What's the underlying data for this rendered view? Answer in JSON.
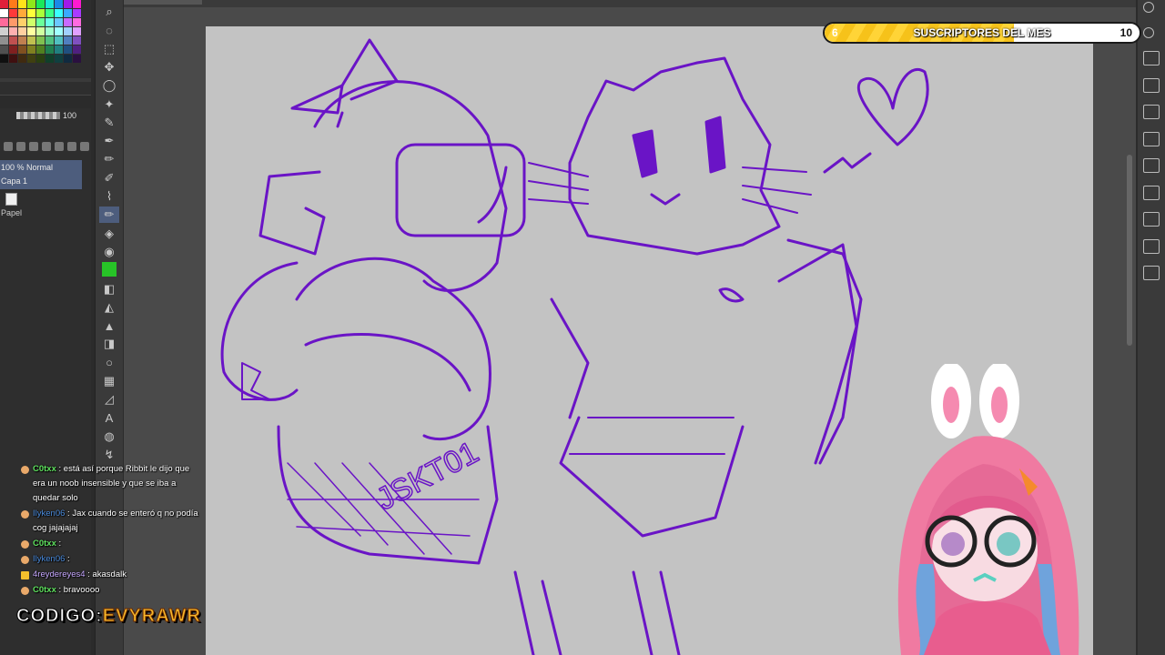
{
  "layer_panel": {
    "opacity_value": "100",
    "blend_label": "100 % Normal",
    "layer_name": "Capa 1",
    "paper_label": "Papel"
  },
  "sub_goal": {
    "current": "6",
    "target": "10",
    "progress": 0.6,
    "label": "SUSCRIPTORES DEL MES",
    "fill_color": "#f6c21a"
  },
  "chat": [
    {
      "user": "C0txx",
      "sep": " : ",
      "text": "está así porque Ribbit le dijo que era un noob insensible y que se iba a quedar solo",
      "badge": "circle"
    },
    {
      "user": "Ilyken06",
      "sep": " : ",
      "text": "Jax cuando se enteró q no podía cog jajajajaj",
      "badge": "circle"
    },
    {
      "user": "C0txx",
      "sep": " : ",
      "text": "",
      "badge": "circle"
    },
    {
      "user": "Ilyken06",
      "sep": " : ",
      "text": "",
      "badge": "circle"
    },
    {
      "user": "4reydereyes4",
      "sep": " : ",
      "text": "akasdalk",
      "badge": "crown"
    },
    {
      "user": "C0txx",
      "sep": " : ",
      "text": "bravoooo",
      "badge": "circle"
    }
  ],
  "promo": {
    "key": "CODIGO:",
    "value": "EVYRAWR"
  },
  "colors": {
    "ink": "#6a14c6",
    "canvas": "#c3c3c3",
    "panel": "#2e2e2e",
    "accent_layer": "#4d5d7d"
  },
  "icons": {
    "tools": [
      "zoom-icon",
      "rotate-icon",
      "move-layer-icon",
      "move-icon",
      "lasso-icon",
      "magic-wand-icon",
      "eyedropper-icon",
      "pen-icon",
      "pencil-icon",
      "brush-icon",
      "airbrush-icon",
      "pencil-active-icon",
      "decoration-icon",
      "stamp-icon",
      "green-color-icon",
      "eraser-icon",
      "blend-icon",
      "fill-icon",
      "gradient-icon",
      "shape-icon",
      "frame-icon",
      "ruler-icon",
      "text-icon",
      "speech-balloon-icon",
      "correct-line-icon"
    ]
  }
}
